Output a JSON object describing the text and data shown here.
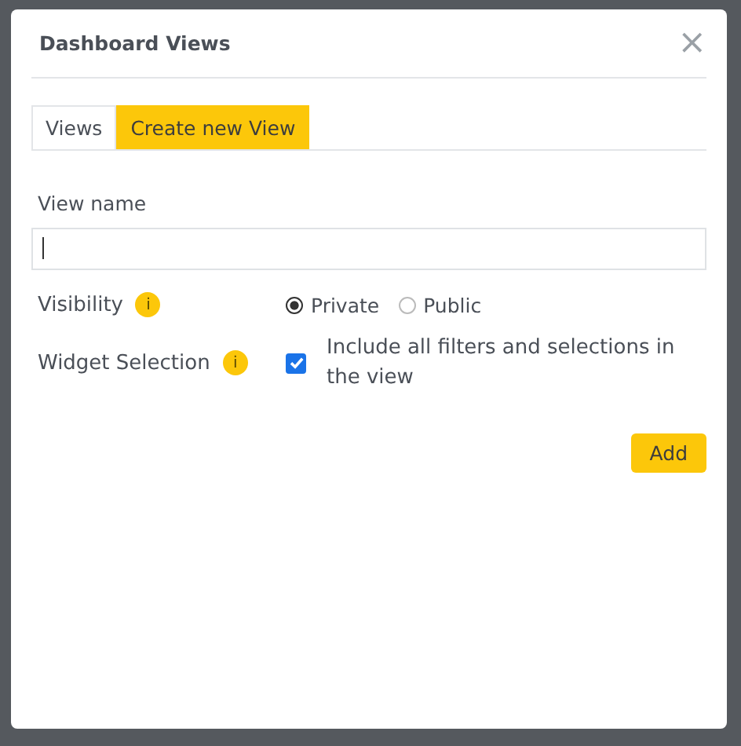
{
  "dialog": {
    "title": "Dashboard Views",
    "close": "×"
  },
  "tabs": [
    {
      "label": "Views",
      "selected": false
    },
    {
      "label": "Create new View",
      "selected": true
    }
  ],
  "view_name": {
    "label": "View name",
    "focused": true
  },
  "visibility": {
    "label": "Visibility",
    "info": "i",
    "options": [
      {
        "label": "Private",
        "selected": true
      },
      {
        "label": "Public",
        "selected": false
      }
    ]
  },
  "widget_selection": {
    "label": "Widget Selection",
    "info": "i",
    "checkbox_label": "Include all filters and selections in the view",
    "checked": true
  },
  "buttons": [
    {
      "label": "Add"
    }
  ]
}
